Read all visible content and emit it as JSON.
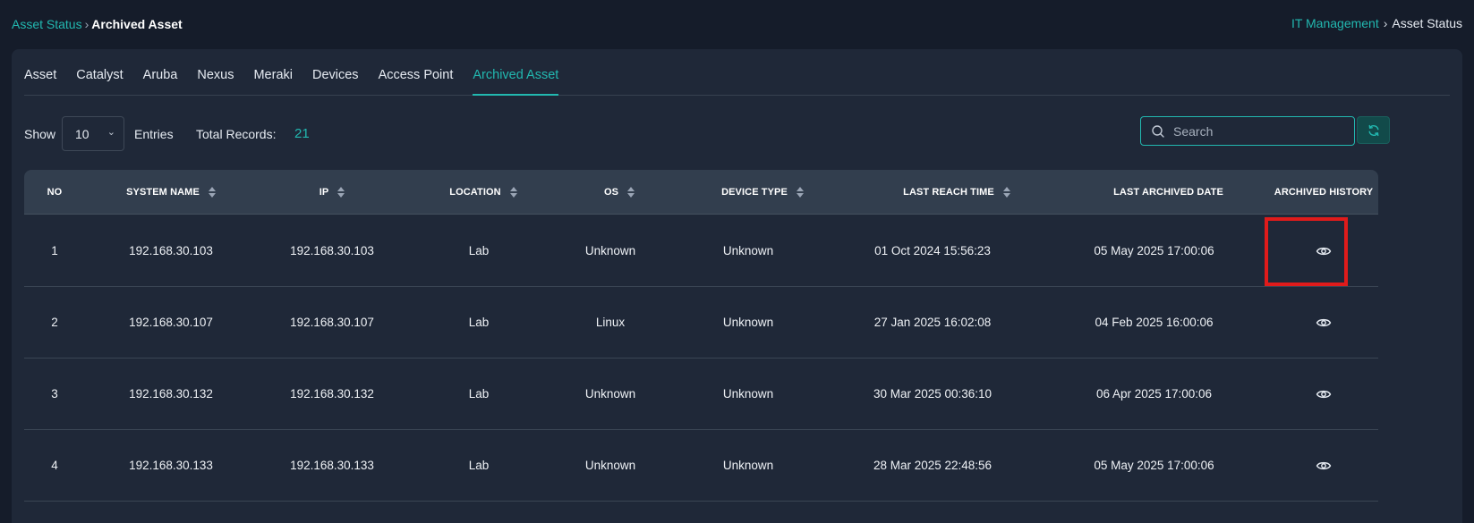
{
  "breadcrumb_left": {
    "parent": "Asset Status",
    "current": "Archived Asset"
  },
  "breadcrumb_right": {
    "parent": "IT Management",
    "current": "Asset Status"
  },
  "tabs": [
    {
      "label": "Asset"
    },
    {
      "label": "Catalyst"
    },
    {
      "label": "Aruba"
    },
    {
      "label": "Nexus"
    },
    {
      "label": "Meraki"
    },
    {
      "label": "Devices"
    },
    {
      "label": "Access Point"
    },
    {
      "label": "Archived Asset",
      "active": true
    }
  ],
  "controls": {
    "show_label": "Show",
    "entries_value": "10",
    "entries_label": "Entries",
    "total_label": "Total Records:",
    "total_value": "21",
    "search_placeholder": "Search"
  },
  "table": {
    "headers": [
      "NO",
      "SYSTEM NAME",
      "IP",
      "LOCATION",
      "OS",
      "DEVICE TYPE",
      "LAST REACH TIME",
      "LAST ARCHIVED DATE",
      "ARCHIVED HISTORY"
    ],
    "rows": [
      {
        "no": "1",
        "system_name": "192.168.30.103",
        "ip": "192.168.30.103",
        "location": "Lab",
        "os": "Unknown",
        "device_type": "Unknown",
        "last_reach": "01 Oct 2024 15:56:23",
        "last_archived": "05 May 2025 17:00:06"
      },
      {
        "no": "2",
        "system_name": "192.168.30.107",
        "ip": "192.168.30.107",
        "location": "Lab",
        "os": "Linux",
        "device_type": "Unknown",
        "last_reach": "27 Jan 2025 16:02:08",
        "last_archived": "04 Feb 2025 16:00:06"
      },
      {
        "no": "3",
        "system_name": "192.168.30.132",
        "ip": "192.168.30.132",
        "location": "Lab",
        "os": "Unknown",
        "device_type": "Unknown",
        "last_reach": "30 Mar 2025 00:36:10",
        "last_archived": "06 Apr 2025 17:00:06"
      },
      {
        "no": "4",
        "system_name": "192.168.30.133",
        "ip": "192.168.30.133",
        "location": "Lab",
        "os": "Unknown",
        "device_type": "Unknown",
        "last_reach": "28 Mar 2025 22:48:56",
        "last_archived": "05 May 2025 17:00:06"
      }
    ]
  },
  "icons": {
    "search": "search-icon",
    "refresh": "refresh-icon",
    "view": "eye-icon",
    "sort": "sort-icon"
  },
  "colors": {
    "accent": "#22b8b0",
    "background": "#151c2a",
    "panel": "#1f2838",
    "header": "#323e4e",
    "highlight": "#e01b1b"
  }
}
